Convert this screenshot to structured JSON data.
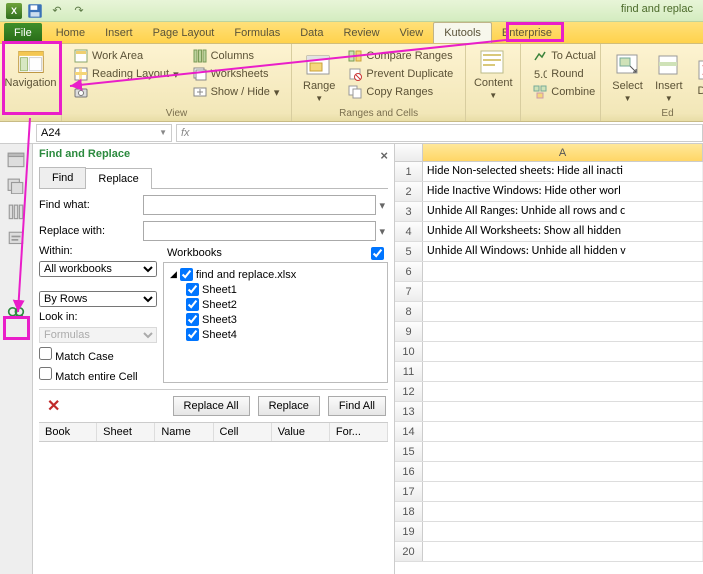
{
  "qat": {
    "title": "find and replac"
  },
  "tabs": [
    "File",
    "Home",
    "Insert",
    "Page Layout",
    "Formulas",
    "Data",
    "Review",
    "View",
    "Kutools",
    "Enterprise"
  ],
  "ribbon": {
    "navigation": "Navigation",
    "view": {
      "work_area": "Work Area",
      "reading_layout": "Reading Layout",
      "columns": "Columns",
      "worksheets": "Worksheets",
      "show_hide": "Show / Hide",
      "label": "View"
    },
    "range": "Range",
    "ranges": {
      "compare": "Compare Ranges",
      "prevent": "Prevent Duplicate",
      "copy": "Copy Ranges",
      "label": "Ranges and Cells"
    },
    "content": "Content",
    "to_actual": "To Actual",
    "round": "Round",
    "combine": "Combine",
    "select": "Select",
    "insert": "Insert",
    "delete": "Dele",
    "editing": "Ed"
  },
  "namebox": "A24",
  "fx": "fx",
  "pane": {
    "title": "Find and Replace",
    "tab_find": "Find",
    "tab_replace": "Replace",
    "find_what": "Find what:",
    "find_what_value": "",
    "replace_with": "Replace with:",
    "replace_with_value": "",
    "within": "Within:",
    "within_value": "All workbooks",
    "search": "By Rows",
    "look_in": "Look in:",
    "look_in_value": "Formulas",
    "match_case": "Match Case",
    "match_entire": "Match entire Cell",
    "workbooks": "Workbooks",
    "tree": {
      "file": "find and replace.xlsx",
      "sheets": [
        "Sheet1",
        "Sheet2",
        "Sheet3",
        "Sheet4"
      ]
    },
    "replace_all": "Replace All",
    "replace": "Replace",
    "find_all": "Find All",
    "cols": [
      "Book",
      "Sheet",
      "Name",
      "Cell",
      "Value",
      "For..."
    ]
  },
  "sheet": {
    "col": "A",
    "rows": [
      "Hide Non-selected sheets: Hide all inacti",
      "Hide Inactive Windows: Hide other worl",
      "Unhide All Ranges: Unhide all rows and c",
      "Unhide All Worksheets: Show all hidden",
      "Unhide All Windows: Unhide all hidden v",
      "",
      "",
      "",
      "",
      "",
      "",
      "",
      "",
      "",
      "",
      "",
      "",
      "",
      "",
      ""
    ]
  }
}
